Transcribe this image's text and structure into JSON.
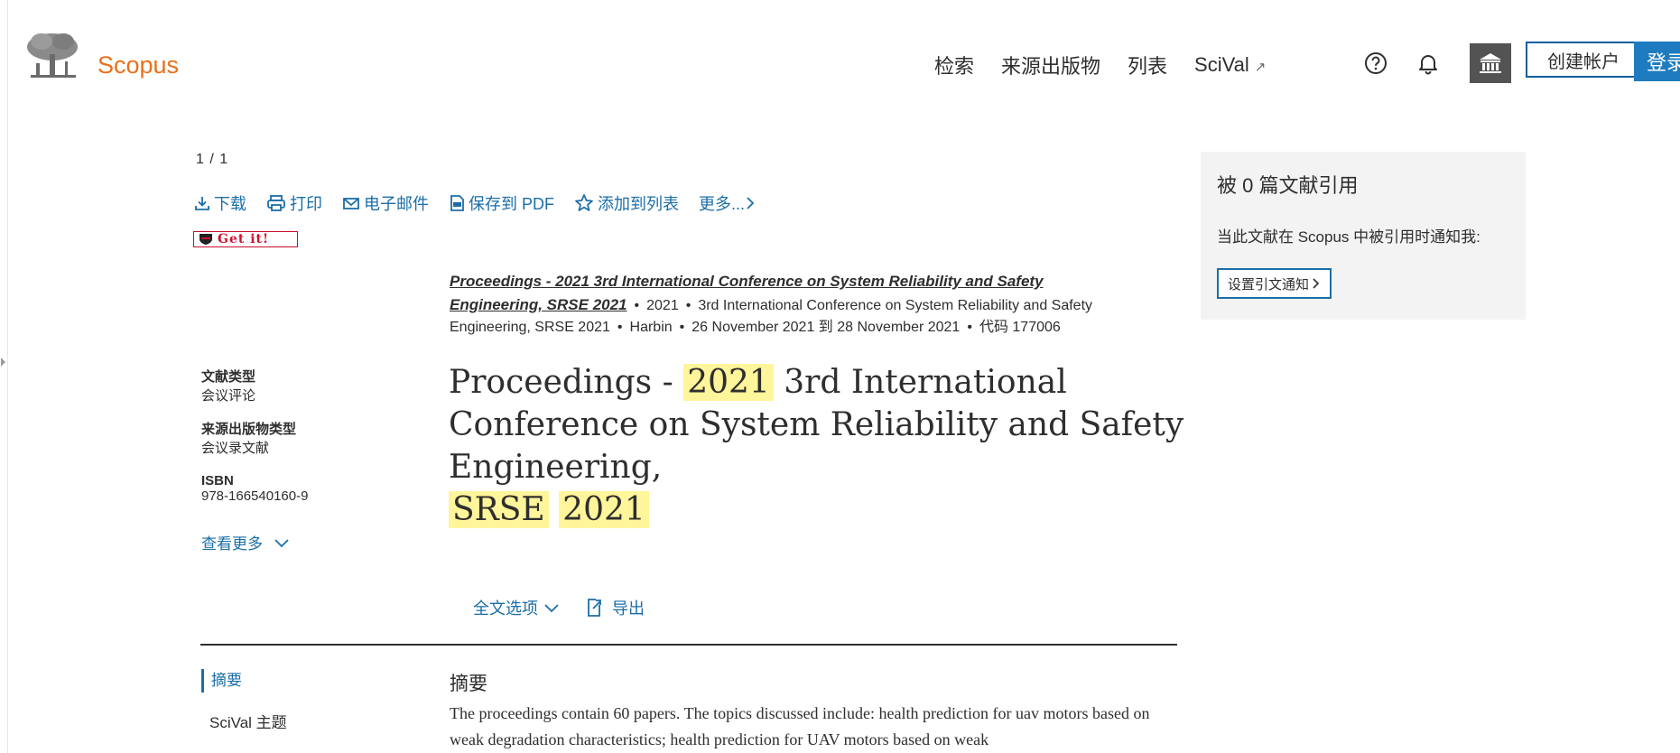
{
  "header": {
    "brand": "Scopus",
    "nav": [
      "检索",
      "来源出版物",
      "列表",
      "SciVal"
    ],
    "create_account": "创建帐户",
    "login": "登录"
  },
  "pager": "1 / 1",
  "toolbar": {
    "download": "下载",
    "print": "打印",
    "email": "电子邮件",
    "save_pdf": "保存到 PDF",
    "add_to_list": "添加到列表",
    "more": "更多..."
  },
  "getit": "Get it!",
  "source": {
    "link_line1": "Proceedings - 2021 3rd International Conference on System Reliability and Safety",
    "link_line2": "Engineering, SRSE 2021",
    "year": "2021",
    "conf_line1": "3rd International Conference on System Reliability and Safety",
    "conf_line2": "Engineering, SRSE 2021",
    "location": "Harbin",
    "dates": "26 November 2021 到 28 November 2021",
    "code": "代码 177006"
  },
  "meta": {
    "doc_type_label": "文献类型",
    "doc_type": "会议评论",
    "source_type_label": "来源出版物类型",
    "source_type": "会议录文献",
    "isbn_label": "ISBN",
    "isbn": "978-166540160-9",
    "see_more": "查看更多"
  },
  "title": {
    "part1": "Proceedings - ",
    "hl1": "2021",
    "part2": " 3rd International Conference on System Reliability and Safety Engineering, ",
    "hl2": "SRSE",
    "hl3": "2021"
  },
  "options": {
    "fulltext": "全文选项",
    "export": "导出"
  },
  "sidenav": {
    "abstract": "摘要",
    "scival": "SciVal 主题"
  },
  "abstract": {
    "heading": "摘要",
    "body": "The proceedings contain 60 papers. The topics discussed include: health prediction for uav motors based on weak degradation characteristics; health prediction for UAV motors based on weak"
  },
  "citations": {
    "heading": "被 0 篇文献引用",
    "desc": "当此文献在 Scopus 中被引用时通知我:",
    "button": "设置引文通知"
  },
  "colors": {
    "brand": "#e9711c",
    "link": "#1b6ea8",
    "highlight": "#fff59a",
    "login_bg": "#1e7bbf"
  }
}
